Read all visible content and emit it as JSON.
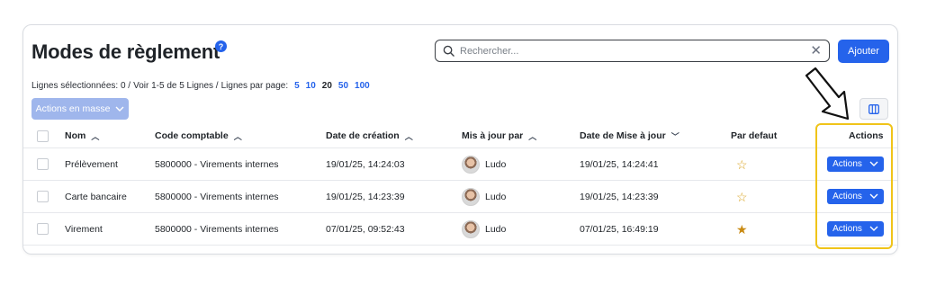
{
  "page": {
    "title": "Modes de règlement",
    "help_glyph": "?",
    "search_placeholder": "Rechercher...",
    "add_label": "Ajouter"
  },
  "info": {
    "selected": "Lignes sélectionnées: 0 /",
    "range": "Voir 1-5 de 5 Lignes /",
    "per_page_label": "Lignes par page:",
    "per_page_options": [
      "5",
      "10",
      "20",
      "50",
      "100"
    ],
    "per_page_current": "20"
  },
  "mass_actions_label": "Actions en masse",
  "columns": {
    "nom": "Nom",
    "code": "Code comptable",
    "creation": "Date de création",
    "maj_par": "Mis à jour par",
    "maj_date": "Date de Mise à jour",
    "defaut": "Par defaut",
    "actions": "Actions"
  },
  "rows": [
    {
      "nom": "Prélèvement",
      "code": "5800000 - Virements internes",
      "creation": "19/01/25, 14:24:03",
      "maj_par": "Ludo",
      "maj_date": "19/01/25, 14:24:41",
      "defaut": false,
      "action": "Actions"
    },
    {
      "nom": "Carte bancaire",
      "code": "5800000 - Virements internes",
      "creation": "19/01/25, 14:23:39",
      "maj_par": "Ludo",
      "maj_date": "19/01/25, 14:23:39",
      "defaut": false,
      "action": "Actions"
    },
    {
      "nom": "Virement",
      "code": "5800000 - Virements internes",
      "creation": "07/01/25, 09:52:43",
      "maj_par": "Ludo",
      "maj_date": "07/01/25, 16:49:19",
      "defaut": true,
      "action": "Actions"
    }
  ],
  "colors": {
    "accent": "#2563eb",
    "highlight": "#f0c419",
    "star": "#d9a320"
  },
  "icons": {
    "search": "search-icon",
    "clear": "close-icon",
    "columns": "columns-icon",
    "chevron": "chevron-down-icon",
    "star": "star-icon"
  }
}
